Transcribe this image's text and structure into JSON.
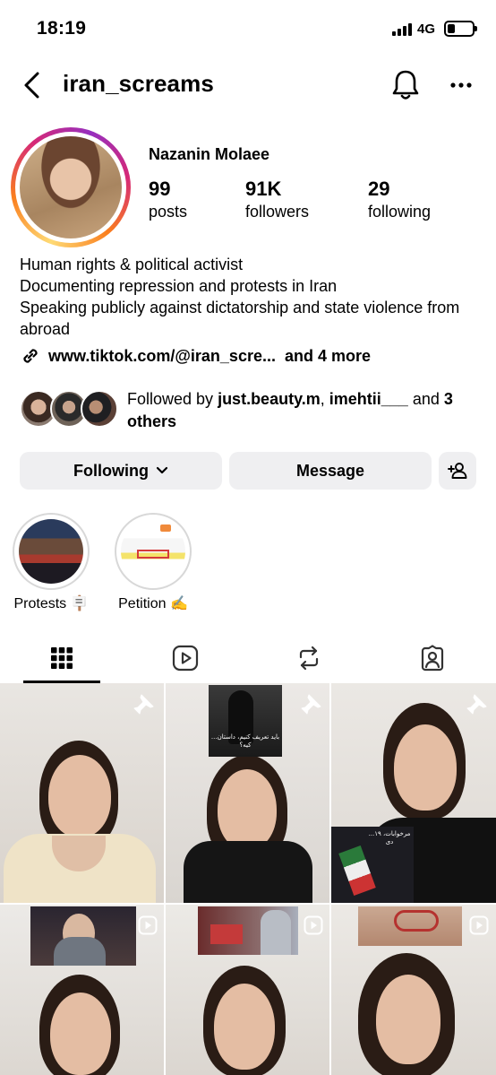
{
  "status_bar": {
    "time": "18:19",
    "network": "4G"
  },
  "header": {
    "username": "iran_screams"
  },
  "profile": {
    "display_name": "Nazanin Molaee",
    "stats": [
      {
        "value": "99",
        "label": "posts"
      },
      {
        "value": "91K",
        "label": "followers"
      },
      {
        "value": "29",
        "label": "following"
      }
    ],
    "bio_lines": [
      "Human rights & political activist",
      "Documenting repression and protests in Iran",
      "Speaking publicly against dictatorship and state violence from abroad"
    ],
    "link_text": "www.tiktok.com/@iran_scre...",
    "link_more": "and 4 more",
    "followed_by": {
      "prefix": "Followed by ",
      "user1": "just.beauty.m",
      "separator": ", ",
      "user2": "imehtii___",
      "middle": " and ",
      "count": "3 others"
    }
  },
  "actions": {
    "following_label": "Following",
    "message_label": "Message"
  },
  "highlights": [
    {
      "label": "Protests 🪧"
    },
    {
      "label": "Petition ✍️"
    }
  ],
  "tabs": [
    "grid-icon",
    "reels-icon",
    "reposts-icon",
    "tagged-icon"
  ],
  "grid_insets": {
    "cell2_caption": "...باید تعریف کنیم، داستان کیه؟",
    "cell3_caption": "...مرخوابات، ۱۹ دی"
  },
  "colors": {
    "button_bg": "#efeff1",
    "ring_start": "#feda75",
    "ring_end": "#962fbf"
  }
}
